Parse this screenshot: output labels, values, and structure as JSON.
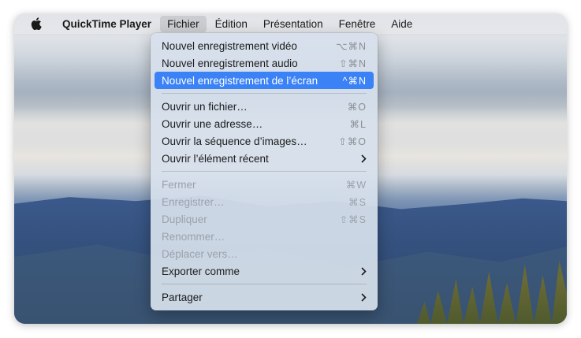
{
  "menubar": {
    "app_name": "QuickTime Player",
    "items": [
      "Fichier",
      "Édition",
      "Présentation",
      "Fenêtre",
      "Aide"
    ]
  },
  "file_menu": {
    "group1": [
      {
        "label": "Nouvel enregistrement vidéo",
        "shortcut": "⌥⌘N"
      },
      {
        "label": "Nouvel enregistrement audio",
        "shortcut": "⇧⌘N"
      },
      {
        "label": "Nouvel enregistrement de l’écran",
        "shortcut": "^⌘N"
      }
    ],
    "group2": [
      {
        "label": "Ouvrir un fichier…",
        "shortcut": "⌘O"
      },
      {
        "label": "Ouvrir une adresse…",
        "shortcut": "⌘L"
      },
      {
        "label": "Ouvrir la séquence d’images…",
        "shortcut": "⇧⌘O"
      },
      {
        "label": "Ouvrir l’élément récent"
      }
    ],
    "group3": [
      {
        "label": "Fermer",
        "shortcut": "⌘W"
      },
      {
        "label": "Enregistrer…",
        "shortcut": "⌘S"
      },
      {
        "label": "Dupliquer",
        "shortcut": "⇧⌘S"
      },
      {
        "label": "Renommer…"
      },
      {
        "label": "Déplacer vers…"
      },
      {
        "label": "Exporter comme"
      }
    ],
    "group4": [
      {
        "label": "Partager"
      }
    ],
    "highlighted_item": "Nouvel enregistrement de l’écran"
  },
  "colors": {
    "highlight": "#3a82f5",
    "disabled_text": "#9aa1aa"
  },
  "icons": [
    "apple-logo-icon",
    "chevron-right-icon"
  ]
}
